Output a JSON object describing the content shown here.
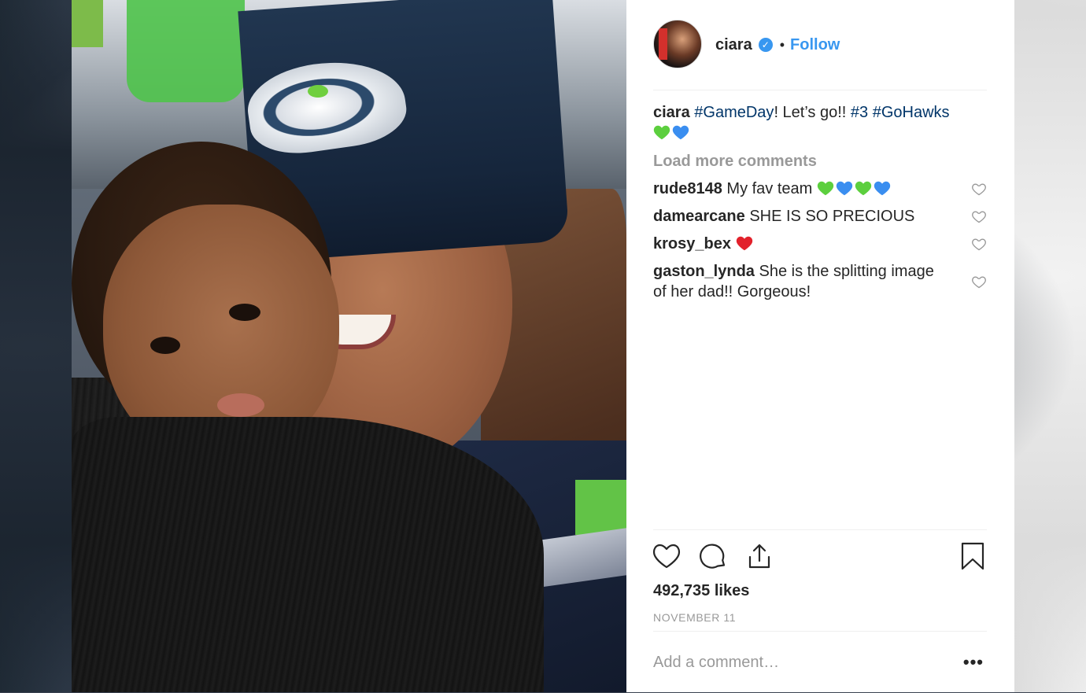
{
  "header": {
    "username": "ciara",
    "verified_glyph": "✓",
    "separator": "•",
    "follow_label": "Follow"
  },
  "caption": {
    "username": "ciara",
    "parts": [
      "#GameDay",
      "! Let’s go!! ",
      "#3",
      " ",
      "#GoHawks"
    ],
    "emojis": [
      "green-heart",
      "blue-heart"
    ]
  },
  "load_more": "Load more comments",
  "comments": [
    {
      "username": "rude8148",
      "text": "My fav team",
      "emojis": [
        "green-heart",
        "blue-heart",
        "green-heart",
        "blue-heart"
      ]
    },
    {
      "username": "damearcane",
      "text": "SHE IS SO PRECIOUS",
      "emojis": []
    },
    {
      "username": "krosy_bex",
      "text": "",
      "emojis": [
        "red-heart"
      ]
    },
    {
      "username": "gaston_lynda",
      "text": "She is the splitting image of her dad!! Gorgeous!",
      "emojis": []
    }
  ],
  "actions": {
    "icons": [
      "heart-icon",
      "comment-icon",
      "share-icon",
      "bookmark-icon"
    ]
  },
  "likes": "492,735 likes",
  "date": "NOVEMBER 11",
  "add_comment": {
    "placeholder": "Add a comment…",
    "more_label": "•••"
  },
  "colors": {
    "link": "#3897f0",
    "hashtag": "#003569",
    "muted": "#999999",
    "text": "#262626",
    "green_heart": "#5ccf3e",
    "blue_heart": "#3a8ef0",
    "red_heart": "#e2212b"
  }
}
